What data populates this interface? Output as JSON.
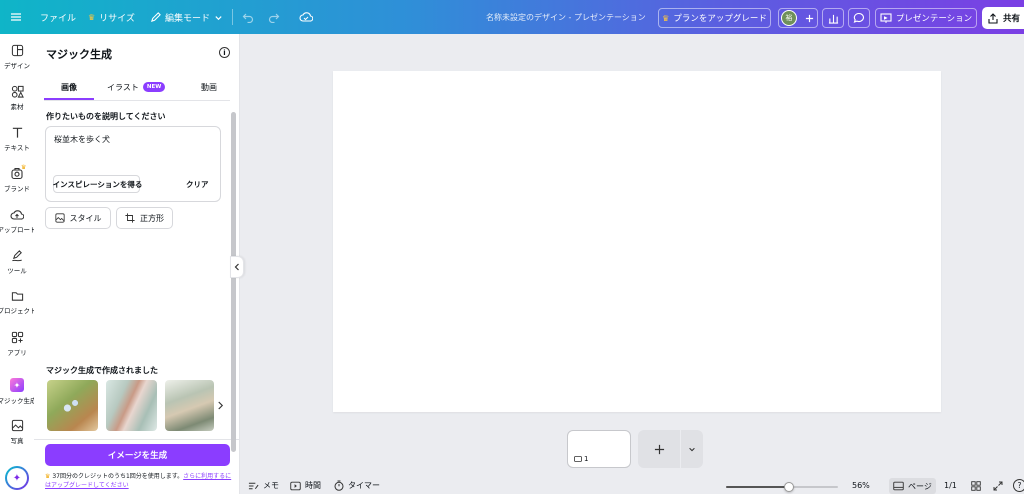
{
  "topbar": {
    "file": "ファイル",
    "resize": "リサイズ",
    "edit_mode": "編集モード",
    "doc_title": "名称未設定のデザイン - プレゼンテーション",
    "upgrade": "プランをアップグレード",
    "avatar": "裕",
    "present": "プレゼンテーション",
    "share": "共有"
  },
  "rail": {
    "items": [
      {
        "label": "デザイン"
      },
      {
        "label": "素材"
      },
      {
        "label": "テキスト"
      },
      {
        "label": "ブランド"
      },
      {
        "label": "アップロード"
      },
      {
        "label": "ツール"
      },
      {
        "label": "プロジェクト"
      },
      {
        "label": "アプリ"
      },
      {
        "label": "マジック生成"
      },
      {
        "label": "写真"
      }
    ]
  },
  "panel": {
    "title": "マジック生成",
    "tabs": [
      {
        "label": "画像"
      },
      {
        "label": "イラスト"
      },
      {
        "label": "動画"
      }
    ],
    "new_badge": "NEW",
    "prompt_label": "作りたいものを説明してください",
    "prompt_value": "桜並木を歩く犬",
    "inspire": "インスピレーションを得る",
    "clear": "クリア",
    "style": "スタイル",
    "aspect": "正方形",
    "created_heading": "マジック生成で作成されました",
    "generate": "イメージを生成",
    "credit_text": "37回分のクレジットのうち1回分を使用します。",
    "credit_link": "さらに利用するにはアップグレードしてください"
  },
  "canvas": {
    "page_number": "1"
  },
  "bottombar": {
    "notes": "メモ",
    "timer_duration": "時間",
    "timer": "タイマー",
    "zoom": "56%",
    "page_view": "ページ",
    "page_count": "1/1",
    "zoom_fraction": 0.56
  },
  "colors": {
    "accent": "#8b3dff",
    "generate_bg": "#8b3dff"
  }
}
